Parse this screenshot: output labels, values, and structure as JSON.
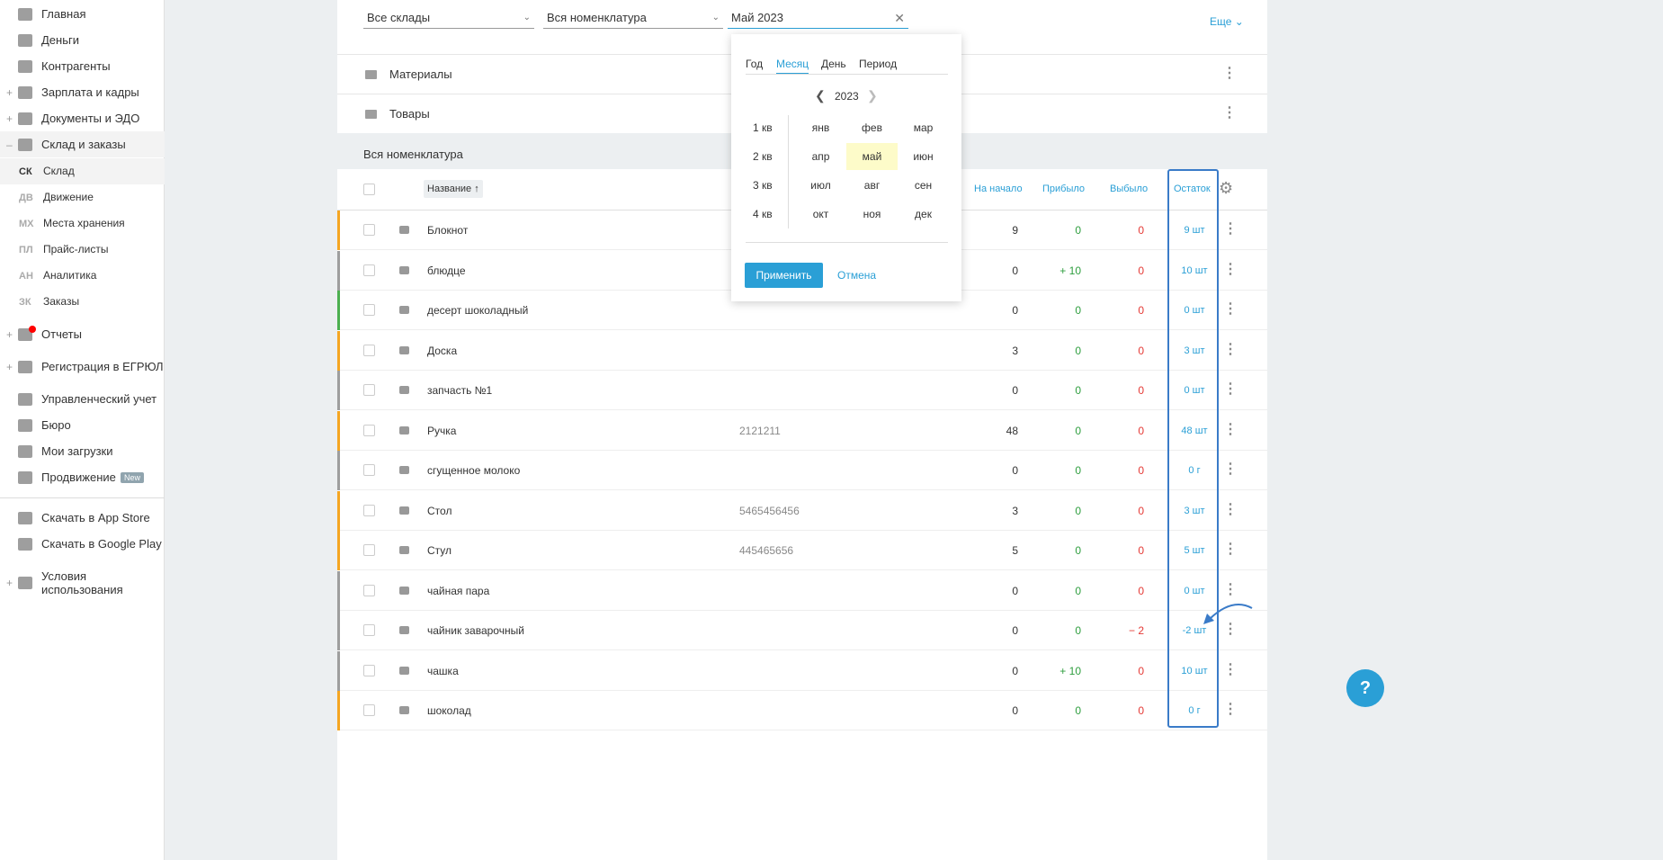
{
  "sidebar": {
    "items": [
      {
        "label": "Главная",
        "icon": "home-icon",
        "plus": ""
      },
      {
        "label": "Деньги",
        "icon": "money-icon",
        "plus": ""
      },
      {
        "label": "Контрагенты",
        "icon": "contractors-icon",
        "plus": ""
      },
      {
        "label": "Зарплата и кадры",
        "icon": "wallet-icon",
        "plus": "+"
      },
      {
        "label": "Документы и ЭДО",
        "icon": "folder-icon",
        "plus": "+"
      },
      {
        "label": "Склад и заказы",
        "icon": "warehouse-icon",
        "plus": "–"
      }
    ],
    "sub": [
      {
        "ab": "СК",
        "label": "Склад"
      },
      {
        "ab": "ДВ",
        "label": "Движение"
      },
      {
        "ab": "МХ",
        "label": "Места хранения"
      },
      {
        "ab": "ПЛ",
        "label": "Прайс-листы"
      },
      {
        "ab": "АН",
        "label": "Аналитика"
      },
      {
        "ab": "ЗК",
        "label": "Заказы"
      }
    ],
    "items2": [
      {
        "label": "Отчеты",
        "plus": "+"
      },
      {
        "label": "Регистрация в ЕГРЮЛ",
        "plus": "+"
      },
      {
        "label": "Управленческий учет",
        "plus": ""
      },
      {
        "label": "Бюро",
        "plus": ""
      },
      {
        "label": "Мои загрузки",
        "plus": ""
      },
      {
        "label": "Продвижение",
        "plus": "",
        "badge": "New"
      }
    ],
    "items3": [
      {
        "label": "Скачать в App Store"
      },
      {
        "label": "Скачать в Google Play"
      },
      {
        "label": "Условия использования",
        "plus": "+"
      }
    ]
  },
  "filters": {
    "warehouse": "Все склады",
    "nomenclature": "Вся номенклатура",
    "period": "Май 2023",
    "more": "Еще"
  },
  "groups": [
    "Материалы",
    "Товары"
  ],
  "section_title": "Вся номенклатура",
  "columns": {
    "name": "Название ↑",
    "start": "На начало",
    "in": "Прибыло",
    "out": "Выбыло",
    "rest": "Остаток"
  },
  "colors": {
    "orange": "#f5a623",
    "gray": "#9e9e9e",
    "green": "#4caf50"
  },
  "rows": [
    {
      "name": "Блокнот",
      "code": "",
      "start": "9",
      "in": "0",
      "out": "0",
      "rest": "9 шт",
      "c": "orange"
    },
    {
      "name": "блюдце",
      "code": "",
      "start": "0",
      "in": "+ 10",
      "out": "0",
      "rest": "10 шт",
      "c": "gray"
    },
    {
      "name": "десерт шоколадный",
      "code": "",
      "start": "0",
      "in": "0",
      "out": "0",
      "rest": "0 шт",
      "c": "green"
    },
    {
      "name": "Доска",
      "code": "",
      "start": "3",
      "in": "0",
      "out": "0",
      "rest": "3 шт",
      "c": "orange"
    },
    {
      "name": "запчасть №1",
      "code": "",
      "start": "0",
      "in": "0",
      "out": "0",
      "rest": "0 шт",
      "c": "gray"
    },
    {
      "name": "Ручка",
      "code": "2121211",
      "start": "48",
      "in": "0",
      "out": "0",
      "rest": "48 шт",
      "c": "orange"
    },
    {
      "name": "сгущенное молоко",
      "code": "",
      "start": "0",
      "in": "0",
      "out": "0",
      "rest": "0 г",
      "c": "gray"
    },
    {
      "name": "Стол",
      "code": "5465456456",
      "start": "3",
      "in": "0",
      "out": "0",
      "rest": "3 шт",
      "c": "orange"
    },
    {
      "name": "Стул",
      "code": "445465656",
      "start": "5",
      "in": "0",
      "out": "0",
      "rest": "5 шт",
      "c": "orange"
    },
    {
      "name": "чайная пара",
      "code": "",
      "start": "0",
      "in": "0",
      "out": "0",
      "rest": "0 шт",
      "c": "gray"
    },
    {
      "name": "чайник заварочный",
      "code": "",
      "start": "0",
      "in": "0",
      "out": "− 2",
      "rest": "-2 шт",
      "c": "gray"
    },
    {
      "name": "чашка",
      "code": "",
      "start": "0",
      "in": "+ 10",
      "out": "0",
      "rest": "10 шт",
      "c": "gray"
    },
    {
      "name": "шоколад",
      "code": "",
      "start": "0",
      "in": "0",
      "out": "0",
      "rest": "0 г",
      "c": "orange"
    }
  ],
  "picker": {
    "tabs": [
      "Год",
      "Месяц",
      "День",
      "Период"
    ],
    "active_tab": "Месяц",
    "year": "2023",
    "quarters": [
      "1 кв",
      "2 кв",
      "3 кв",
      "4 кв"
    ],
    "months": [
      "янв",
      "фев",
      "мар",
      "апр",
      "май",
      "июн",
      "июл",
      "авг",
      "сен",
      "окт",
      "ноя",
      "дек"
    ],
    "selected": "май",
    "apply": "Применить",
    "cancel": "Отмена"
  },
  "help": "?"
}
